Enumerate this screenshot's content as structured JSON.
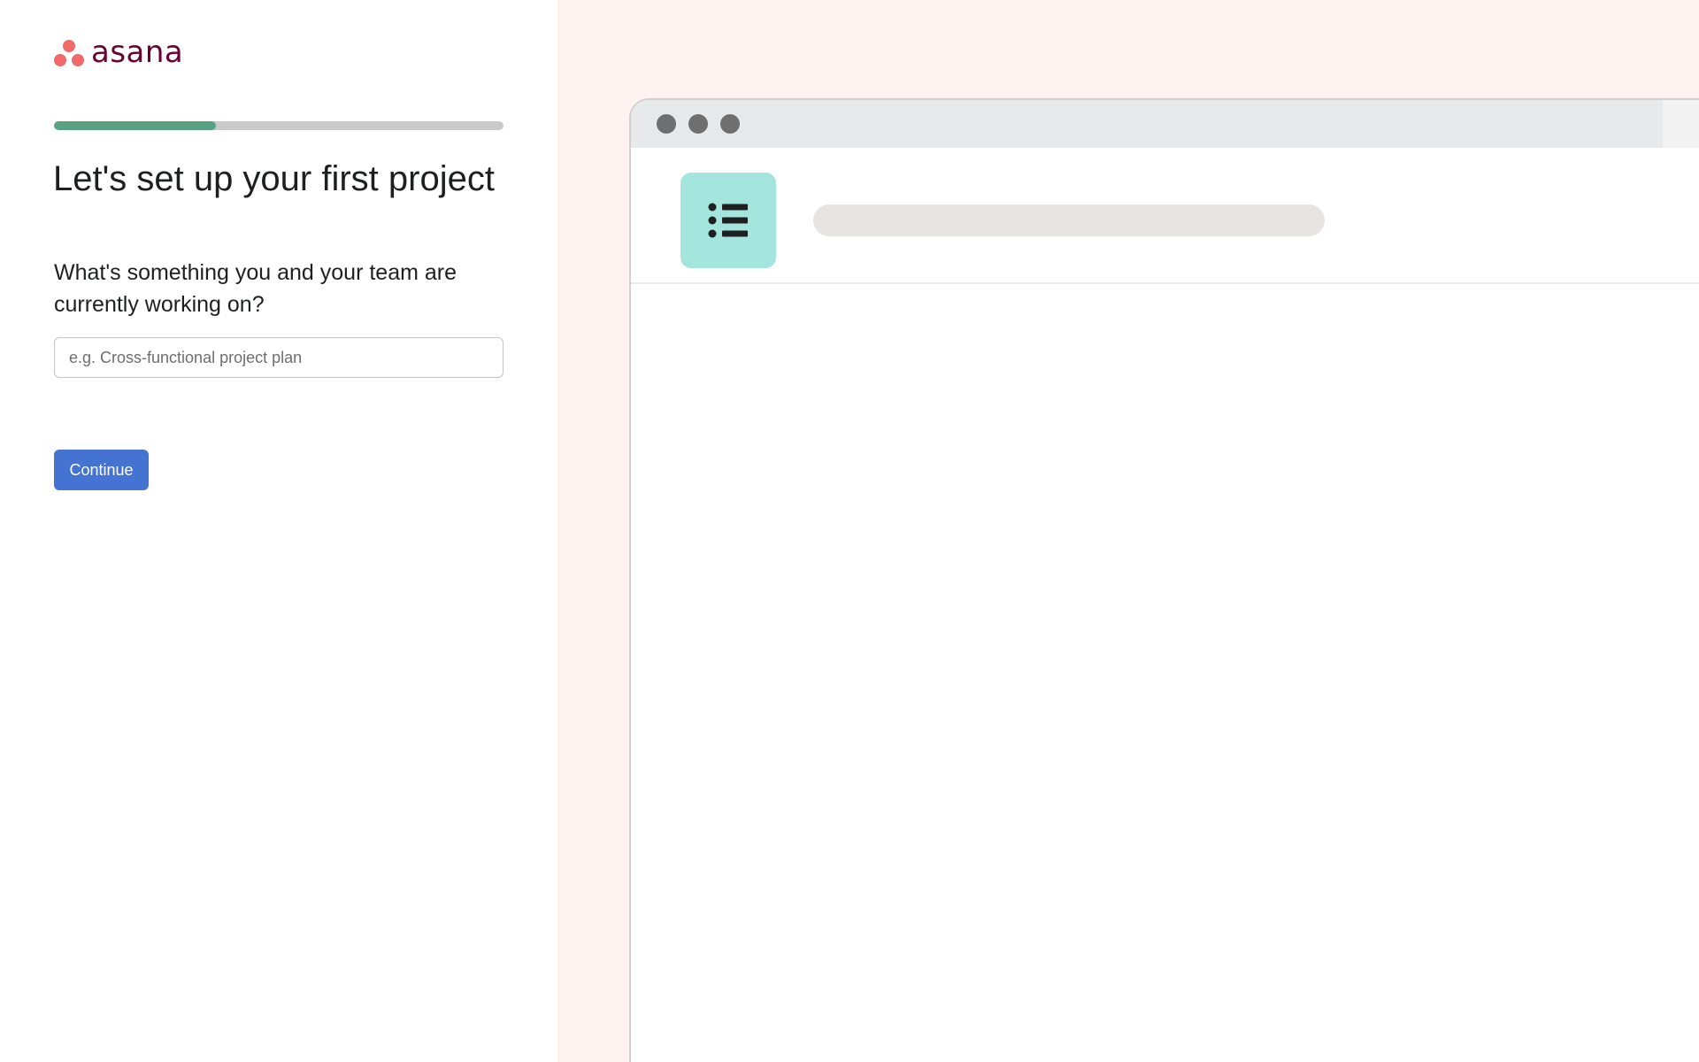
{
  "brand": {
    "name": "asana",
    "dot_color": "#f06a6a",
    "wordmark_color": "#690031"
  },
  "progress": {
    "fraction": 0.36,
    "fill_color": "#58a182"
  },
  "form": {
    "title": "Let's set up your first project",
    "question": "What's something you and your team are currently working on?",
    "input_value": "",
    "input_placeholder": "e.g. Cross-functional project plan",
    "continue_label": "Continue",
    "button_color": "#4573d2"
  },
  "preview": {
    "background": "#fff3f2",
    "icon": "list-icon",
    "icon_bg": "#a4e6dd"
  }
}
